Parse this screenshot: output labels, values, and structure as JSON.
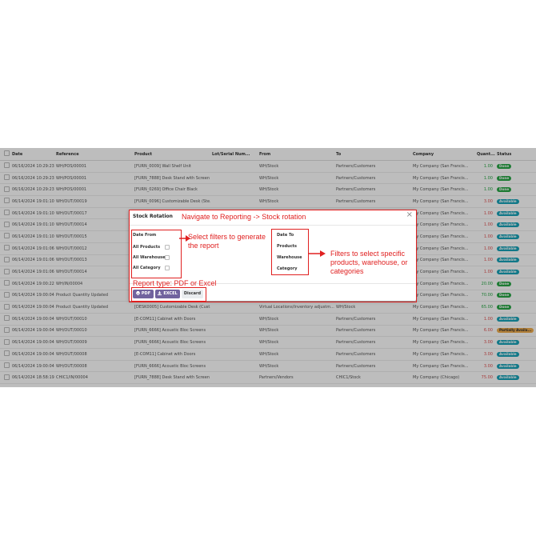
{
  "table": {
    "headers": [
      "",
      "Date",
      "Reference",
      "Product",
      "Lot/Serial Num...",
      "From",
      "To",
      "Company",
      "Quant...",
      "Status"
    ],
    "rows": [
      [
        "06/16/2024 10:29:23",
        "WH/POS/00001",
        "[FURN_0009] Wall Shelf Unit",
        "",
        "WH/Stock",
        "Partners/Customers",
        "My Company (San Francis...",
        "1.00",
        "Done"
      ],
      [
        "06/16/2024 10:29:23",
        "WH/POS/00001",
        "[FURN_7888] Desk Stand with Screen",
        "",
        "WH/Stock",
        "Partners/Customers",
        "My Company (San Francis...",
        "1.00",
        "Done"
      ],
      [
        "06/16/2024 10:29:23",
        "WH/POS/00001",
        "[FURN_0269] Office Chair Black",
        "",
        "WH/Stock",
        "Partners/Customers",
        "My Company (San Francis...",
        "1.00",
        "Done"
      ],
      [
        "06/14/2024 19:01:10",
        "WH/OUT/00019",
        "[FURN_0096] Customizable Desk (Ste...",
        "",
        "WH/Stock",
        "Partners/Customers",
        "My Company (San Francis...",
        "3.00",
        "Available"
      ],
      [
        "06/14/2024 19:01:10",
        "WH/OUT/00017",
        "",
        "",
        "",
        "",
        "My Company (San Francis...",
        "1.00",
        "Available"
      ],
      [
        "06/14/2024 19:01:10",
        "WH/OUT/00014",
        "",
        "",
        "",
        "",
        "My Company (San Francis...",
        "1.00",
        "Available"
      ],
      [
        "06/14/2024 19:01:10",
        "WH/OUT/00015",
        "",
        "",
        "",
        "",
        "My Company (San Francis...",
        "1.00",
        "Available"
      ],
      [
        "06/14/2024 19:01:06",
        "WH/OUT/00012",
        "",
        "",
        "",
        "",
        "My Company (San Francis...",
        "1.00",
        "Available"
      ],
      [
        "06/14/2024 19:01:06",
        "WH/OUT/00013",
        "",
        "",
        "",
        "",
        "My Company (San Francis...",
        "1.00",
        "Available"
      ],
      [
        "06/14/2024 19:01:06",
        "WH/OUT/00014",
        "",
        "",
        "",
        "",
        "My Company (San Francis...",
        "1.00",
        "Available"
      ],
      [
        "06/14/2024 19:00:22",
        "WH/IN/00004",
        "",
        "",
        "",
        "",
        "My Company (San Francis...",
        "20.00",
        "Done"
      ],
      [
        "06/14/2024 19:00:04",
        "Product Quantity Updated",
        "",
        "",
        "",
        "",
        "My Company (San Francis...",
        "70.00",
        "Done"
      ],
      [
        "06/14/2024 19:00:04",
        "Product Quantity Updated",
        "[DESK0005] Customizable Desk (Cust...",
        "",
        "Virtual Locations/Inventory adjustm...",
        "WH/Stock",
        "My Company (San Francis...",
        "65.00",
        "Done"
      ],
      [
        "06/14/2024 19:00:04",
        "WH/OUT/00010",
        "[E-COM11] Cabinet with Doors",
        "",
        "WH/Stock",
        "Partners/Customers",
        "My Company (San Francis...",
        "1.00",
        "Available"
      ],
      [
        "06/14/2024 19:00:04",
        "WH/OUT/00010",
        "[FURN_6666] Acoustic Bloc Screens",
        "",
        "WH/Stock",
        "Partners/Customers",
        "My Company (San Francis...",
        "6.00",
        "Partially Availa..."
      ],
      [
        "06/14/2024 19:00:04",
        "WH/OUT/00009",
        "[FURN_6666] Acoustic Bloc Screens",
        "",
        "WH/Stock",
        "Partners/Customers",
        "My Company (San Francis...",
        "3.00",
        "Available"
      ],
      [
        "06/14/2024 19:00:04",
        "WH/OUT/00008",
        "[E-COM11] Cabinet with Doors",
        "",
        "WH/Stock",
        "Partners/Customers",
        "My Company (San Francis...",
        "3.00",
        "Available"
      ],
      [
        "06/14/2024 19:00:04",
        "WH/OUT/00008",
        "[FURN_6666] Acoustic Bloc Screens",
        "",
        "WH/Stock",
        "Partners/Customers",
        "My Company (San Francis...",
        "3.00",
        "Available"
      ],
      [
        "06/14/2024 18:58:19",
        "CHIC1/IN/00004",
        "[FURN_7888] Desk Stand with Screen",
        "",
        "Partners/Vendors",
        "CHIC1/Stock",
        "My Company (Chicago)",
        "75.00",
        "Available"
      ]
    ]
  },
  "status_colors": {
    "Done": "#28a745",
    "Available": "#17a2b8",
    "Partially Availa...": "#f0ad4e"
  },
  "modal": {
    "title": "Stock Rotation",
    "close_icon": "×",
    "date_from": "Date From",
    "all_products": "All Products",
    "all_warehouse": "All Warehouse",
    "all_category": "All Category",
    "date_to": "Date To",
    "products": "Products",
    "warehouse": "Warehouse",
    "category": "Category",
    "pdf_label": "PDF",
    "excel_label": "EXCEL",
    "discard_label": "Discard",
    "pdf_icon": "printer-icon",
    "excel_icon": "download-icon"
  },
  "annotations": {
    "navigate": "Navigate to Reporting -> Stock rotation",
    "select_filters": "Select filters to generate the report",
    "filters_specific": "Filters to select specific products, warehouse, or categories",
    "report_type": "Report type: PDF or Excel"
  },
  "accent_color": "#e02020"
}
